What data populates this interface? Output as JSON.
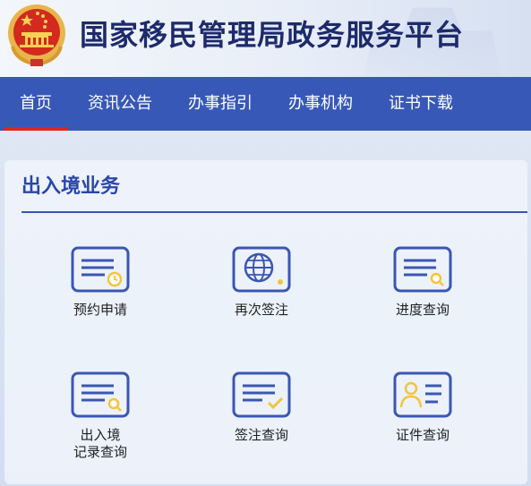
{
  "site": {
    "title": "国家移民管理局政务服务平台"
  },
  "nav": {
    "items": [
      {
        "label": "首页",
        "active": true
      },
      {
        "label": "资讯公告"
      },
      {
        "label": "办事指引"
      },
      {
        "label": "办事机构"
      },
      {
        "label": "证书下载"
      }
    ]
  },
  "panel": {
    "title": "出入境业务",
    "services": [
      {
        "label": "预约申请",
        "icon": "card-clock-icon"
      },
      {
        "label": "再次签注",
        "icon": "globe-card-icon"
      },
      {
        "label": "进度查询",
        "icon": "card-search-icon"
      },
      {
        "label_lines": [
          "出入境",
          "记录查询"
        ],
        "icon": "card-search-icon"
      },
      {
        "label": "签注查询",
        "icon": "card-check-icon"
      },
      {
        "label": "证件查询",
        "icon": "id-card-icon"
      }
    ]
  },
  "colors": {
    "nav_bg": "#3758b6",
    "active_underline": "#e1251b",
    "title": "#1d2a6b",
    "icon_blue": "#3b56b3",
    "icon_yellow": "#f3c53c"
  }
}
